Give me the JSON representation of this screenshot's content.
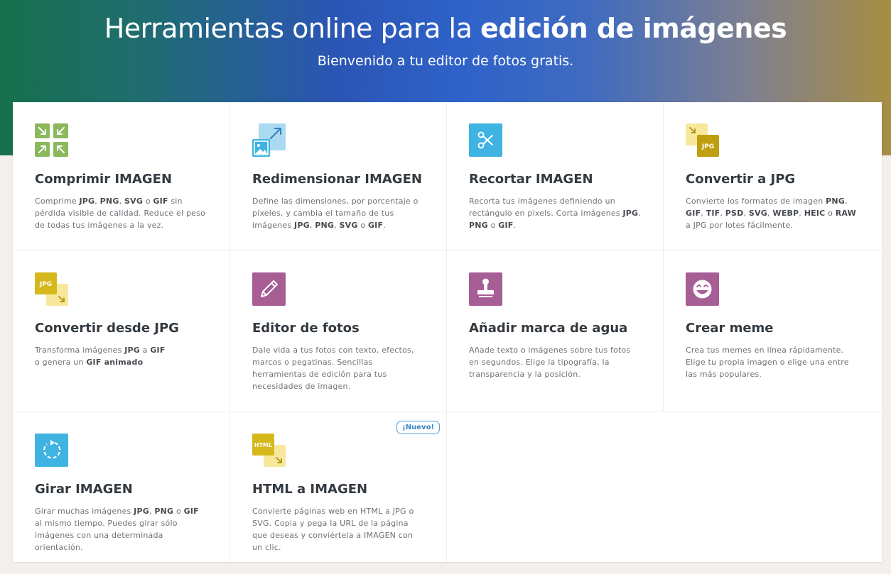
{
  "header": {
    "title_part1": "Herramientas online para la",
    "title_part2": "edición de imágenes",
    "subtitle": "Bienvenido a tu editor de fotos gratis."
  },
  "tools": [
    {
      "title": "Comprimir IMAGEN",
      "icon": "compress-icon",
      "icon_color": "#8cb85c",
      "desc": [
        {
          "t": "Comprime "
        },
        {
          "b": "JPG"
        },
        {
          "t": ", "
        },
        {
          "b": "PNG"
        },
        {
          "t": ", "
        },
        {
          "b": "SVG"
        },
        {
          "t": " o "
        },
        {
          "b": "GIF"
        },
        {
          "t": " sin pérdida visible de calidad. Reduce el peso de todas tus imágenes a la vez."
        }
      ]
    },
    {
      "title": "Redimensionar IMAGEN",
      "icon": "resize-icon",
      "icon_color": "#3fb3e2",
      "desc": [
        {
          "t": "Define las dimensiones, por porcentaje o píxeles, y cambia el tamaño de tus imágenes "
        },
        {
          "b": "JPG"
        },
        {
          "t": ", "
        },
        {
          "b": "PNG"
        },
        {
          "t": ", "
        },
        {
          "b": "SVG"
        },
        {
          "t": " o "
        },
        {
          "b": "GIF"
        },
        {
          "t": "."
        }
      ]
    },
    {
      "title": "Recortar IMAGEN",
      "icon": "scissors-icon",
      "icon_color": "#3fb3e2",
      "desc": [
        {
          "t": "Recorta tus imágenes definiendo un rectángulo en pixels. Corta imágenes "
        },
        {
          "b": "JPG"
        },
        {
          "t": ", "
        },
        {
          "b": "PNG"
        },
        {
          "t": " o "
        },
        {
          "b": "GIF"
        },
        {
          "t": "."
        }
      ]
    },
    {
      "title": "Convertir a JPG",
      "icon": "convert-to-jpg-icon",
      "icon_label": "JPG",
      "icon_color": "#c9a80f",
      "desc": [
        {
          "t": "Convierte los formatos de imagen "
        },
        {
          "b": "PNG"
        },
        {
          "t": ", "
        },
        {
          "b": "GIF"
        },
        {
          "t": ", "
        },
        {
          "b": "TIF"
        },
        {
          "t": ", "
        },
        {
          "b": "PSD"
        },
        {
          "t": ", "
        },
        {
          "b": "SVG"
        },
        {
          "t": ", "
        },
        {
          "b": "WEBP"
        },
        {
          "t": ", "
        },
        {
          "b": "HEIC"
        },
        {
          "t": " o "
        },
        {
          "b": "RAW"
        },
        {
          "t": " a JPG por lotes fácilmente."
        }
      ]
    },
    {
      "title": "Convertir desde JPG",
      "icon": "convert-from-jpg-icon",
      "icon_label": "JPG",
      "icon_color": "#d6b81c",
      "desc": [
        {
          "t": "Transforma imágenes "
        },
        {
          "b": "JPG"
        },
        {
          "t": " a "
        },
        {
          "b": "GIF"
        },
        {
          "br": true
        },
        {
          "t": "o genera un "
        },
        {
          "b": "GIF animado"
        }
      ]
    },
    {
      "title": "Editor de fotos",
      "icon": "pencil-icon",
      "icon_color": "#a65e95",
      "desc": [
        {
          "t": "Dale vida a tus fotos con texto, efectos, marcos o pegatinas. Sencillas herramientas de edición para tus necesidades de imagen."
        }
      ]
    },
    {
      "title": "Añadir marca de agua",
      "icon": "stamp-icon",
      "icon_color": "#a65e95",
      "desc": [
        {
          "t": "Añade texto o imágenes sobre tus fotos en segundos. Elige la tipografía, la transparencia y la posición."
        }
      ]
    },
    {
      "title": "Crear meme",
      "icon": "meme-face-icon",
      "icon_color": "#a65e95",
      "desc": [
        {
          "t": "Crea tus memes en línea rápidamente. Elige tu propia imagen o elige una entre las más populares."
        }
      ]
    },
    {
      "title": "Girar IMAGEN",
      "icon": "rotate-icon",
      "icon_color": "#3fb3e2",
      "desc": [
        {
          "t": "Girar muchas imágenes "
        },
        {
          "b": "JPG"
        },
        {
          "t": ", "
        },
        {
          "b": "PNG"
        },
        {
          "t": " o "
        },
        {
          "b": "GIF"
        },
        {
          "t": " al mismo tiempo. Puedes girar sólo imágenes con una determinada orientación."
        }
      ]
    },
    {
      "title": "HTML a IMAGEN",
      "icon": "html-to-image-icon",
      "icon_label": "HTML",
      "icon_color": "#d6b81c",
      "badge": "¡Nuevo!",
      "desc": [
        {
          "t": "Convierte páginas web en HTML a JPG o SVG. Copia y pega la URL de la página que deseas y conviértela a IMAGEN con un clic."
        }
      ]
    }
  ]
}
